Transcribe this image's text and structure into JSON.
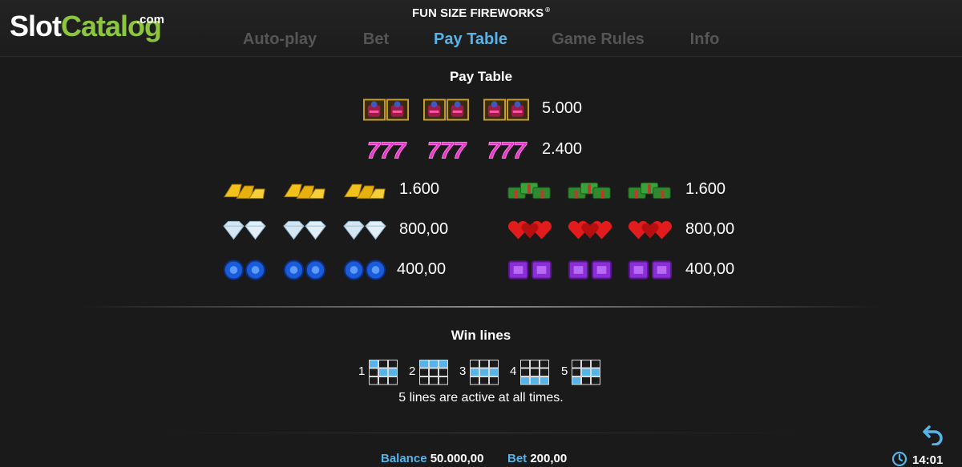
{
  "brand": {
    "name_part1": "Slot",
    "name_part2": "Catalog",
    "suffix": ".com"
  },
  "game_title": "FUN SIZE FIREWORKS",
  "registered_mark": "®",
  "tabs": [
    {
      "label": "Auto-play",
      "active": false
    },
    {
      "label": "Bet",
      "active": false
    },
    {
      "label": "Pay Table",
      "active": true
    },
    {
      "label": "Game Rules",
      "active": false
    },
    {
      "label": "Info",
      "active": false
    }
  ],
  "pay_table": {
    "title": "Pay Table",
    "rows": [
      {
        "symbol": "firecracker-icon",
        "payout": "5.000"
      },
      {
        "symbol": "pink-sevens-icon",
        "payout": "2.400"
      },
      {
        "symbol": "gold-bars-icon",
        "payout": "1.600"
      },
      {
        "symbol": "cash-stacks-icon",
        "payout": "1.600"
      },
      {
        "symbol": "diamonds-icon",
        "payout": "800,00"
      },
      {
        "symbol": "red-hearts-icon",
        "payout": "800,00"
      },
      {
        "symbol": "blue-gems-icon",
        "payout": "400,00"
      },
      {
        "symbol": "purple-gems-icon",
        "payout": "400,00"
      }
    ]
  },
  "win_lines": {
    "title": "Win lines",
    "lines": [
      {
        "number": "1",
        "cells": [
          1,
          0,
          0,
          0,
          1,
          1,
          0,
          0,
          0
        ]
      },
      {
        "number": "2",
        "cells": [
          1,
          1,
          1,
          0,
          0,
          0,
          0,
          0,
          0
        ]
      },
      {
        "number": "3",
        "cells": [
          0,
          0,
          0,
          1,
          1,
          1,
          0,
          0,
          0
        ]
      },
      {
        "number": "4",
        "cells": [
          0,
          0,
          0,
          0,
          0,
          0,
          1,
          1,
          1
        ]
      },
      {
        "number": "5",
        "cells": [
          0,
          0,
          0,
          0,
          1,
          1,
          1,
          0,
          0
        ]
      }
    ],
    "note": "5 lines are active at all times."
  },
  "status_bar": {
    "balance_label": "Balance",
    "balance_value": "50.000,00",
    "bet_label": "Bet",
    "bet_value": "200,00",
    "time": "14:01"
  },
  "colors": {
    "accent": "#57b4e9",
    "brand_green": "#8cc63f",
    "background": "#1a1a1a"
  }
}
